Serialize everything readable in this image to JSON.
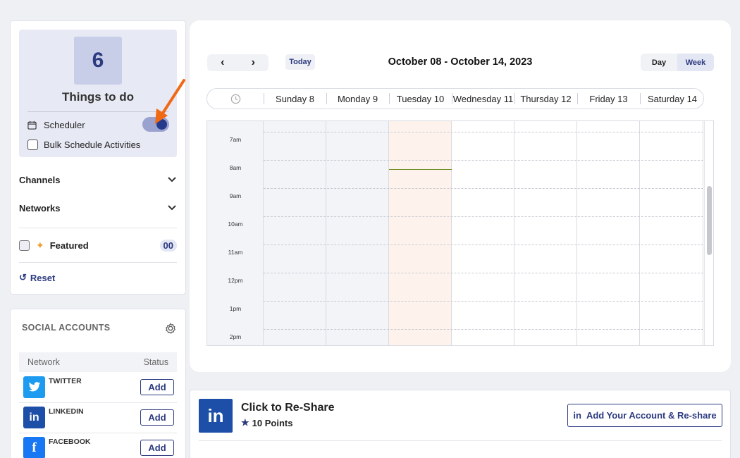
{
  "todo": {
    "count": "6",
    "title": "Things to do"
  },
  "scheduler": {
    "label": "Scheduler",
    "enabled": true
  },
  "bulk": {
    "label": "Bulk Schedule Activities"
  },
  "filters": {
    "channels": "Channels",
    "networks": "Networks",
    "featured": "Featured",
    "featured_count": "00",
    "reset": "Reset"
  },
  "social": {
    "heading": "SOCIAL ACCOUNTS",
    "col_network": "Network",
    "col_status": "Status",
    "accounts": [
      {
        "name": "TWITTER",
        "button": "Add",
        "color": "#1d9bf0",
        "icon": "twitter-icon"
      },
      {
        "name": "LINKEDIN",
        "button": "Add",
        "color": "#1d4fa8",
        "icon": "linkedin-icon"
      },
      {
        "name": "FACEBOOK",
        "button": "Add",
        "color": "#1877f2",
        "icon": "facebook-icon"
      }
    ]
  },
  "calendar": {
    "prev": "‹",
    "next": "›",
    "today": "Today",
    "range": "October 08 - October 14, 2023",
    "views": [
      "Day",
      "Week"
    ],
    "active_view": "Week",
    "days": [
      "Sunday 8",
      "Monday 9",
      "Tuesday 10",
      "Wednesday 11",
      "Thursday 12",
      "Friday 13",
      "Saturday 14"
    ],
    "times": [
      "7am",
      "8am",
      "9am",
      "10am",
      "11am",
      "12pm",
      "1pm",
      "2pm"
    ]
  },
  "share": {
    "title": "Click to Re-Share",
    "points": "10 Points",
    "button": "Add Your Account & Re-share"
  },
  "colors": {
    "accent": "#2c3a80",
    "today_col": "#fdf3ec",
    "past_col": "#f3f4f8",
    "arrow": "#f06a16"
  }
}
